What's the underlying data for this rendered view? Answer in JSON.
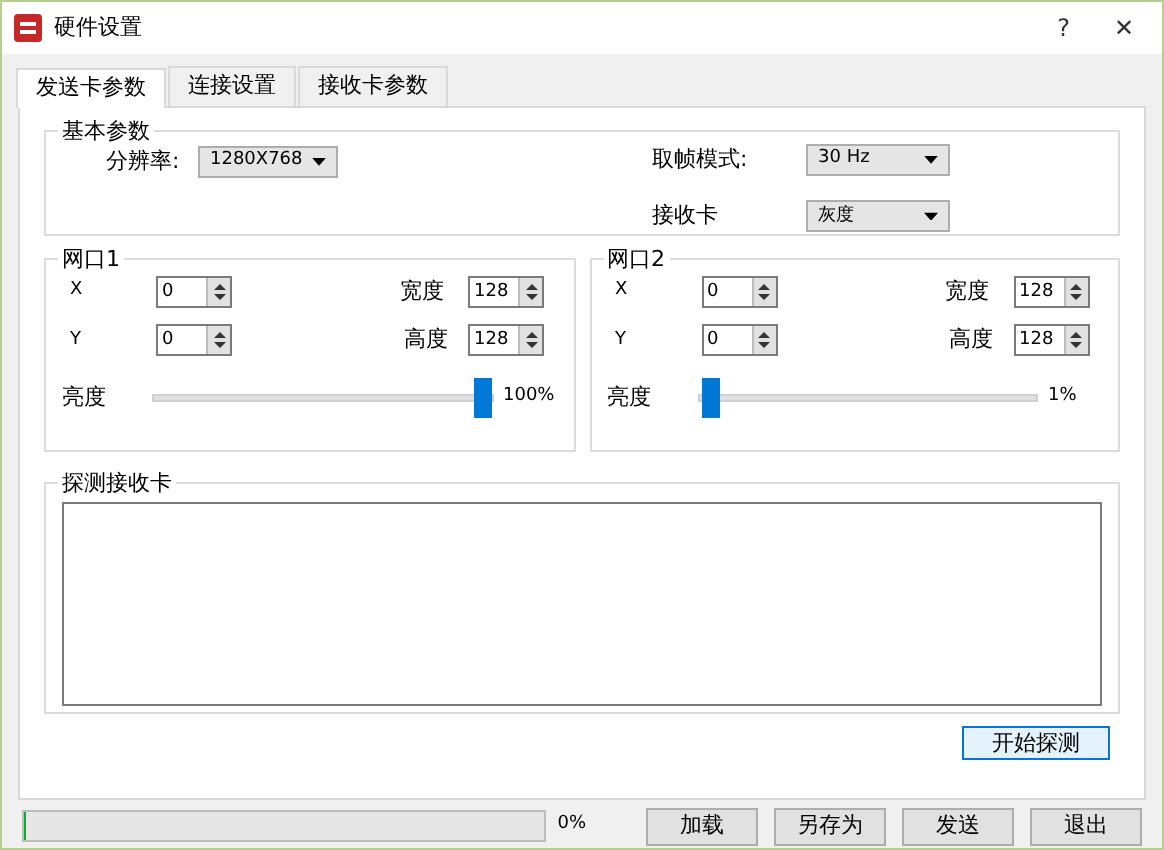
{
  "window": {
    "title": "硬件设置",
    "help": "?",
    "close": "✕"
  },
  "tabs": [
    {
      "label": "发送卡参数",
      "selected": true
    },
    {
      "label": "连接设置",
      "selected": false
    },
    {
      "label": "接收卡参数",
      "selected": false
    }
  ],
  "basic": {
    "title": "基本参数",
    "resolution": {
      "label": "分辨率:",
      "value": "1280X768"
    },
    "frame_mode": {
      "label": "取帧模式:",
      "value": "30 Hz"
    },
    "receiver_card": {
      "label": "接收卡",
      "value": "灰度"
    }
  },
  "ports": [
    {
      "title": "网口1",
      "x": {
        "label": "X",
        "value": "0"
      },
      "y": {
        "label": "Y",
        "value": "0"
      },
      "width": {
        "label": "宽度",
        "value": "128"
      },
      "height": {
        "label": "高度",
        "value": "128"
      },
      "brightness": {
        "label": "亮度",
        "level": 1.0,
        "reading": "100%"
      }
    },
    {
      "title": "网口2",
      "x": {
        "label": "X",
        "value": "0"
      },
      "y": {
        "label": "Y",
        "value": "0"
      },
      "width": {
        "label": "宽度",
        "value": "128"
      },
      "height": {
        "label": "高度",
        "value": "128"
      },
      "brightness": {
        "label": "亮度",
        "level": 0.01,
        "reading": "1%"
      }
    }
  ],
  "detect": {
    "title": "探测接收卡",
    "button": "开始探测"
  },
  "footer": {
    "progress": {
      "level": 0,
      "reading": "0%"
    },
    "buttons": [
      "加载",
      "另存为",
      "发送",
      "退出"
    ]
  }
}
